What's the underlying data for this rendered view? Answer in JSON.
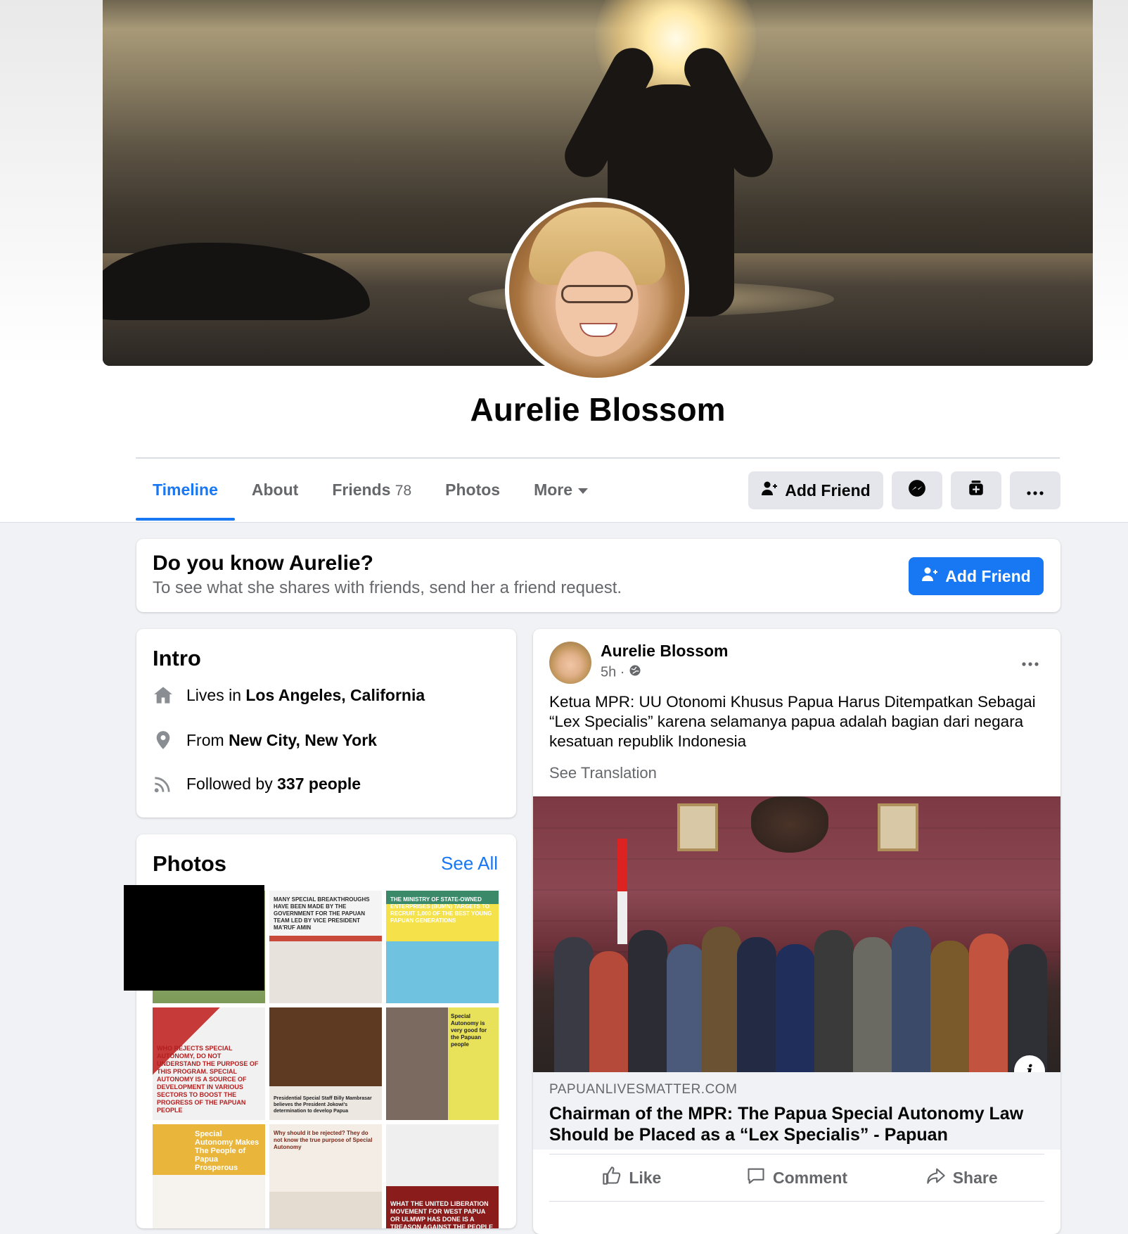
{
  "profile": {
    "name": "Aurelie Blossom"
  },
  "nav": {
    "tabs": [
      {
        "label": "Timeline"
      },
      {
        "label": "About"
      },
      {
        "label": "Friends",
        "count": "78"
      },
      {
        "label": "Photos"
      },
      {
        "label": "More"
      }
    ],
    "add_friend_label": "Add Friend"
  },
  "know_card": {
    "title": "Do you know Aurelie?",
    "subtitle": "To see what she shares with friends, send her a friend request.",
    "button_label": "Add Friend"
  },
  "intro": {
    "title": "Intro",
    "lives_prefix": "Lives in",
    "lives_value": "Los Angeles, California",
    "from_prefix": "From",
    "from_value": "New City, New York",
    "followed_prefix": "Followed by",
    "followed_value": "337 people"
  },
  "photos": {
    "title": "Photos",
    "see_all": "See All",
    "thumbs": [
      {
        "caption": ""
      },
      {
        "caption": "MANY SPECIAL BREAKTHROUGHS HAVE BEEN MADE BY THE GOVERNMENT FOR THE PAPUAN TEAM LED BY VICE PRESIDENT MA'RUF AMIN"
      },
      {
        "caption": "THE MINISTRY OF STATE-OWNED ENTERPRISES (BUMN) TARGETS TO RECRUIT 1,000 OF THE BEST YOUNG PAPUAN GENERATIONS"
      },
      {
        "caption": "WHO REJECTS SPECIAL AUTONOMY, DO NOT UNDERSTAND THE PURPOSE OF THIS PROGRAM. SPECIAL AUTONOMY IS A SOURCE OF DEVELOPMENT IN VARIOUS SECTORS TO BOOST THE PROGRESS OF THE PAPUAN PEOPLE"
      },
      {
        "caption": "Presidential Special Staff Billy Mambrasar believes the President Jokowi's determination to develop Papua"
      },
      {
        "caption": "Special Autonomy is very good for the Papuan people"
      },
      {
        "caption": "Special Autonomy Makes The People of Papua Prosperous"
      },
      {
        "caption": "Why should it be rejected? They do not know the true purpose of Special Autonomy"
      },
      {
        "caption": "WHAT THE UNITED LIBERATION MOVEMENT FOR WEST PAPUA OR ULMWP HAS DONE IS A TREASON AGAINST THE PEOPLE"
      }
    ]
  },
  "post": {
    "author": "Aurelie Blossom",
    "time": "5h · ",
    "text": "Ketua MPR: UU Otonomi Khusus Papua Harus Ditempatkan Sebagai “Lex Specialis” karena selamanya papua adalah bagian dari negara kesatuan republik Indonesia",
    "see_translation": "See Translation",
    "link_domain": "PAPUANLIVESMATTER.COM",
    "link_title": "Chairman of the MPR: The Papua Special Autonomy Law Should be Placed as a “Lex Specialis” - Papuan",
    "info_glyph": "i",
    "actions": {
      "like": "Like",
      "comment": "Comment",
      "share": "Share"
    }
  },
  "colors": {
    "accent": "#1877f2",
    "page_bg": "#f0f2f5",
    "secondary_text": "#65676b"
  }
}
